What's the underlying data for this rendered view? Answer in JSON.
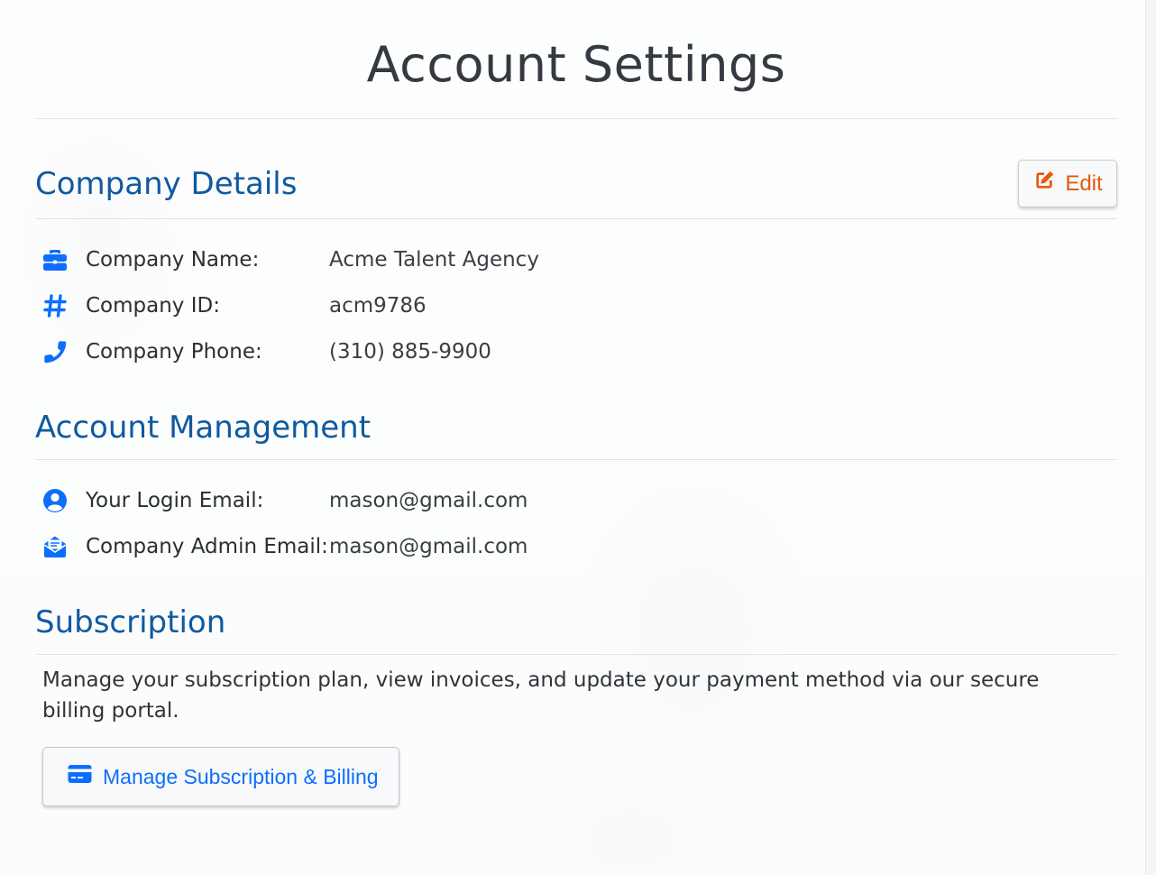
{
  "page": {
    "title": "Account Settings"
  },
  "company_details": {
    "heading": "Company Details",
    "edit_label": "Edit",
    "fields": [
      {
        "icon": "briefcase-icon",
        "label": "Company Name:",
        "value": "Acme Talent Agency"
      },
      {
        "icon": "hashtag-icon",
        "label": "Company ID:",
        "value": "acm9786"
      },
      {
        "icon": "phone-icon",
        "label": "Company Phone:",
        "value": "(310) 885-9900"
      }
    ]
  },
  "account_management": {
    "heading": "Account Management",
    "fields": [
      {
        "icon": "user-circle-icon",
        "label": "Your Login Email:",
        "value": "mason@gmail.com"
      },
      {
        "icon": "envelope-open-icon",
        "label": "Company Admin Email:",
        "value": "mason@gmail.com"
      }
    ]
  },
  "subscription": {
    "heading": "Subscription",
    "description": "Manage your subscription plan, view invoices, and update your payment method via our secure billing portal.",
    "button_label": "Manage Subscription & Billing",
    "button_icon": "credit-card-icon"
  },
  "colors": {
    "heading_blue": "#0f5aa0",
    "icon_blue": "#0d6efd",
    "edit_orange": "#e8590c"
  }
}
